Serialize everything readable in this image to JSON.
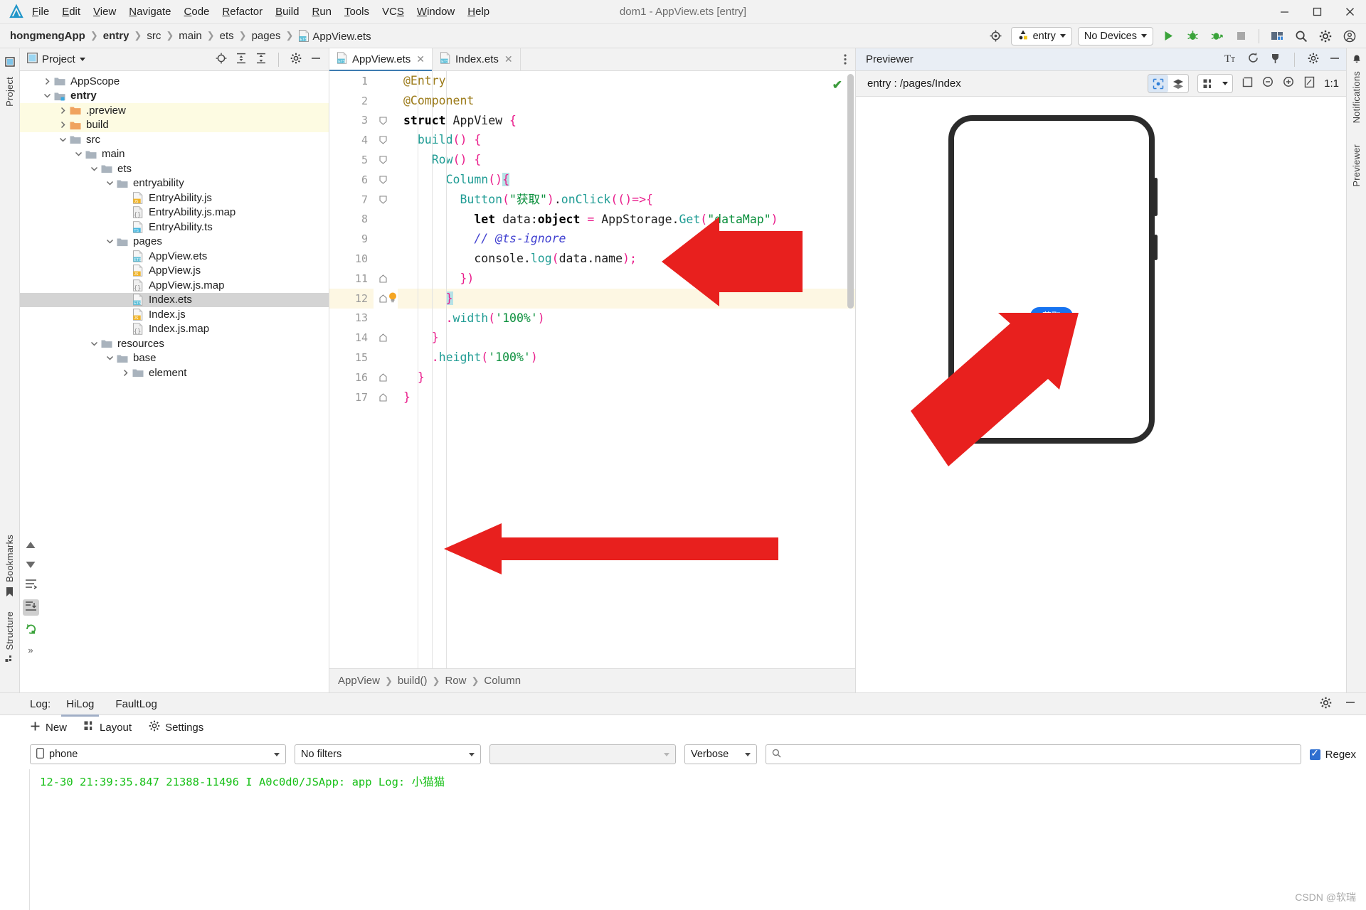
{
  "window": {
    "title": "dom1 - AppView.ets [entry]",
    "controls": {
      "minimize": "–",
      "maximize": "□",
      "close": "✕"
    }
  },
  "menubar": {
    "items": [
      {
        "label": "File",
        "mnemonic": "F"
      },
      {
        "label": "Edit",
        "mnemonic": "E"
      },
      {
        "label": "View",
        "mnemonic": "V"
      },
      {
        "label": "Navigate",
        "mnemonic": "N"
      },
      {
        "label": "Code",
        "mnemonic": "C"
      },
      {
        "label": "Refactor",
        "mnemonic": "R"
      },
      {
        "label": "Build",
        "mnemonic": "B"
      },
      {
        "label": "Run",
        "mnemonic": "R"
      },
      {
        "label": "Tools",
        "mnemonic": "T"
      },
      {
        "label": "VCS",
        "mnemonic": "S"
      },
      {
        "label": "Window",
        "mnemonic": "W"
      },
      {
        "label": "Help",
        "mnemonic": "H"
      }
    ]
  },
  "navbar": {
    "breadcrumb": [
      "hongmengApp",
      "entry",
      "src",
      "main",
      "ets",
      "pages",
      "AppView.ets"
    ],
    "module_selector": "entry",
    "device_selector": "No Devices"
  },
  "project_panel": {
    "title": "Project",
    "tree": [
      {
        "label": "AppScope",
        "depth": 1,
        "arrow": "right",
        "icon": "folder",
        "state": "none"
      },
      {
        "label": "entry",
        "depth": 1,
        "arrow": "down",
        "icon": "folder-mod",
        "state": "bold"
      },
      {
        "label": ".preview",
        "depth": 2,
        "arrow": "right",
        "icon": "folder-orange",
        "state": "yellow"
      },
      {
        "label": "build",
        "depth": 2,
        "arrow": "right",
        "icon": "folder-orange",
        "state": "yellow"
      },
      {
        "label": "src",
        "depth": 2,
        "arrow": "down",
        "icon": "folder",
        "state": "none"
      },
      {
        "label": "main",
        "depth": 3,
        "arrow": "down",
        "icon": "folder",
        "state": "none"
      },
      {
        "label": "ets",
        "depth": 4,
        "arrow": "down",
        "icon": "folder",
        "state": "none"
      },
      {
        "label": "entryability",
        "depth": 5,
        "arrow": "down",
        "icon": "folder",
        "state": "none"
      },
      {
        "label": "EntryAbility.js",
        "depth": 6,
        "arrow": "none",
        "icon": "file-js",
        "state": "none"
      },
      {
        "label": "EntryAbility.js.map",
        "depth": 6,
        "arrow": "none",
        "icon": "file-map",
        "state": "none"
      },
      {
        "label": "EntryAbility.ts",
        "depth": 6,
        "arrow": "none",
        "icon": "file-ts",
        "state": "none"
      },
      {
        "label": "pages",
        "depth": 5,
        "arrow": "down",
        "icon": "folder",
        "state": "none"
      },
      {
        "label": "AppView.ets",
        "depth": 6,
        "arrow": "none",
        "icon": "file-ets",
        "state": "none"
      },
      {
        "label": "AppView.js",
        "depth": 6,
        "arrow": "none",
        "icon": "file-js",
        "state": "none"
      },
      {
        "label": "AppView.js.map",
        "depth": 6,
        "arrow": "none",
        "icon": "file-map",
        "state": "none"
      },
      {
        "label": "Index.ets",
        "depth": 6,
        "arrow": "none",
        "icon": "file-ets",
        "state": "selected"
      },
      {
        "label": "Index.js",
        "depth": 6,
        "arrow": "none",
        "icon": "file-js",
        "state": "none"
      },
      {
        "label": "Index.js.map",
        "depth": 6,
        "arrow": "none",
        "icon": "file-map",
        "state": "none"
      },
      {
        "label": "resources",
        "depth": 4,
        "arrow": "down",
        "icon": "folder",
        "state": "none"
      },
      {
        "label": "base",
        "depth": 5,
        "arrow": "down",
        "icon": "folder",
        "state": "none"
      },
      {
        "label": "element",
        "depth": 6,
        "arrow": "right",
        "icon": "folder",
        "state": "none"
      }
    ]
  },
  "editor": {
    "tabs": [
      {
        "label": "AppView.ets",
        "active": true,
        "icon": "file-ets"
      },
      {
        "label": "Index.ets",
        "active": false,
        "icon": "file-ets"
      }
    ],
    "line_numbers": [
      "1",
      "2",
      "3",
      "4",
      "5",
      "6",
      "7",
      "8",
      "9",
      "10",
      "11",
      "12",
      "13",
      "14",
      "15",
      "16",
      "17"
    ],
    "code_lines": [
      "@Entry",
      "@Component",
      "struct AppView {",
      "  build() {",
      "    Row() {",
      "      Column(){",
      "        Button(\"获取\").onClick(()=>{",
      "          let data:object = AppStorage.Get(\"dataMap\")",
      "          // @ts-ignore",
      "          console.log(data.name);",
      "        })",
      "      }",
      "      .width('100%')",
      "    }",
      "    .height('100%')",
      "  }",
      "}"
    ],
    "highlighted_line": 12,
    "breadcrumb": [
      "AppView",
      "build()",
      "Row",
      "Column"
    ],
    "inspection_status": "✔"
  },
  "previewer": {
    "title": "Previewer",
    "route": "entry : /pages/Index",
    "zoom_label": "1:1",
    "device_button_label": "获取"
  },
  "log_panel": {
    "label": "Log:",
    "tabs": [
      {
        "label": "HiLog",
        "active": true
      },
      {
        "label": "FaultLog",
        "active": false
      }
    ],
    "toolbar": [
      {
        "label": "New",
        "icon": "plus-icon"
      },
      {
        "label": "Layout",
        "icon": "grid-icon"
      },
      {
        "label": "Settings",
        "icon": "gear-icon"
      }
    ],
    "filters": {
      "device": "phone",
      "filter": "No filters",
      "process": "",
      "level": "Verbose",
      "search_placeholder": "",
      "regex_label": "Regex",
      "regex_checked": true
    },
    "lines": [
      "12-30 21:39:35.847 21388-11496 I A0c0d0/JSApp: app Log: 小猫猫"
    ]
  },
  "rails": {
    "left": [
      "Project",
      "Bookmarks",
      "Structure"
    ],
    "right": [
      "Notifications",
      "Previewer"
    ]
  },
  "watermark": "CSDN @软瑞",
  "colors": {
    "accent_blue": "#1773f0",
    "log_green": "#18c018",
    "arrow_red": "#e8201e",
    "tab_underline": "#3e7cb1",
    "highlight_yellow": "#fdfbe2",
    "selection_grey": "#d4d4d4"
  }
}
